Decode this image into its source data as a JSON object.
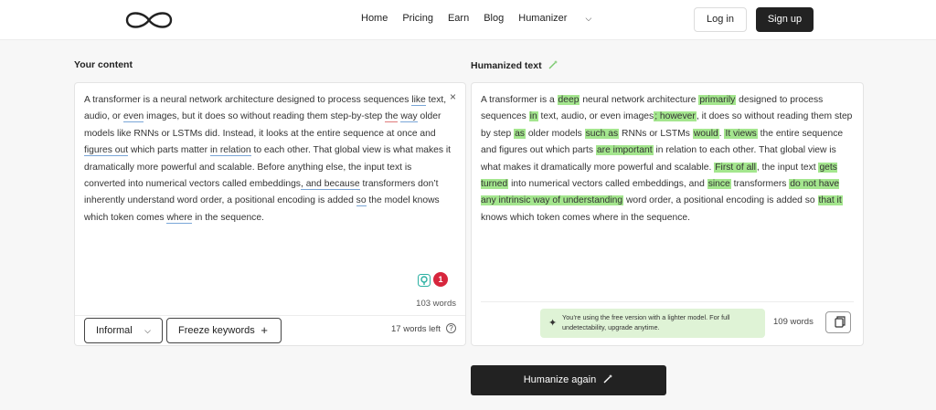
{
  "nav": {
    "items": [
      "Home",
      "Pricing",
      "Earn",
      "Blog",
      "Humanizer"
    ],
    "login": "Log in",
    "signup": "Sign up"
  },
  "left": {
    "label": "Your content",
    "text_segments": [
      {
        "t": "A transformer is a neural network architecture designed to process sequences "
      },
      {
        "t": "like",
        "u": "blue"
      },
      {
        "t": " text, audio, or "
      },
      {
        "t": "even",
        "u": "blue"
      },
      {
        "t": " images, but it does so without reading them step-by-step "
      },
      {
        "t": "the",
        "u": "red"
      },
      {
        "t": " "
      },
      {
        "t": "way",
        "u": "blue"
      },
      {
        "t": " older models like RNNs or LSTMs did. Instead, it looks at the entire sequence at once and "
      },
      {
        "t": "figures out",
        "u": "blue"
      },
      {
        "t": " which parts matter "
      },
      {
        "t": "in relation",
        "u": "blue"
      },
      {
        "t": " to each other. That global view is what makes it dramatically more powerful and scalable. Before anything else, the input text is converted into numerical vectors called embeddings"
      },
      {
        "t": ", and because",
        "u": "blue"
      },
      {
        "t": " transformers don’t inherently understand word order, a positional encoding is added "
      },
      {
        "t": "so",
        "u": "blue"
      },
      {
        "t": " the model knows which token comes "
      },
      {
        "t": "where",
        "u": "blue"
      },
      {
        "t": " in the sequence."
      }
    ],
    "badge_count": "1",
    "word_count": "103 words",
    "tone_label": "Informal",
    "freeze_label": "Freeze keywords",
    "words_left": "17 words left",
    "help": "?",
    "close": "×"
  },
  "right": {
    "label": "Humanized text",
    "text_segments": [
      {
        "t": "A transformer is a "
      },
      {
        "t": "deep",
        "h": true
      },
      {
        "t": " neural network architecture "
      },
      {
        "t": "primarily",
        "h": true
      },
      {
        "t": " designed to process sequences "
      },
      {
        "t": "in",
        "h": true
      },
      {
        "t": " text, audio, or even images"
      },
      {
        "t": "; however",
        "h": true
      },
      {
        "t": ", it does so without reading them step by step "
      },
      {
        "t": "as",
        "h": true
      },
      {
        "t": " older models "
      },
      {
        "t": "such as",
        "h": true
      },
      {
        "t": " RNNs or LSTMs "
      },
      {
        "t": "would",
        "h": true
      },
      {
        "t": ". "
      },
      {
        "t": "It views",
        "h": true
      },
      {
        "t": " the entire sequence and figures out which parts "
      },
      {
        "t": "are important",
        "h": true
      },
      {
        "t": " in relation to each other. That global view is what makes it dramatically more powerful and scalable. "
      },
      {
        "t": "First of all",
        "h": true
      },
      {
        "t": ", the input text "
      },
      {
        "t": "gets turned",
        "h": true
      },
      {
        "t": " into numerical vectors called embeddings, and "
      },
      {
        "t": "since",
        "h": true
      },
      {
        "t": " transformers "
      },
      {
        "t": "do not have any intrinsic way of understanding",
        "h": true
      },
      {
        "t": " word order, a positional encoding is added so "
      },
      {
        "t": "that it",
        "h": true
      },
      {
        "t": " knows which token comes where in the sequence."
      }
    ],
    "notice": "You’re using the free version with a lighter model. For full undetectability, upgrade anytime.",
    "word_count": "109 words"
  },
  "humanize_again": "Humanize again",
  "colors": {
    "highlight": "#a4e68e",
    "dark": "#222222",
    "notice_bg": "#dff3d6",
    "badge": "#d7263d"
  }
}
